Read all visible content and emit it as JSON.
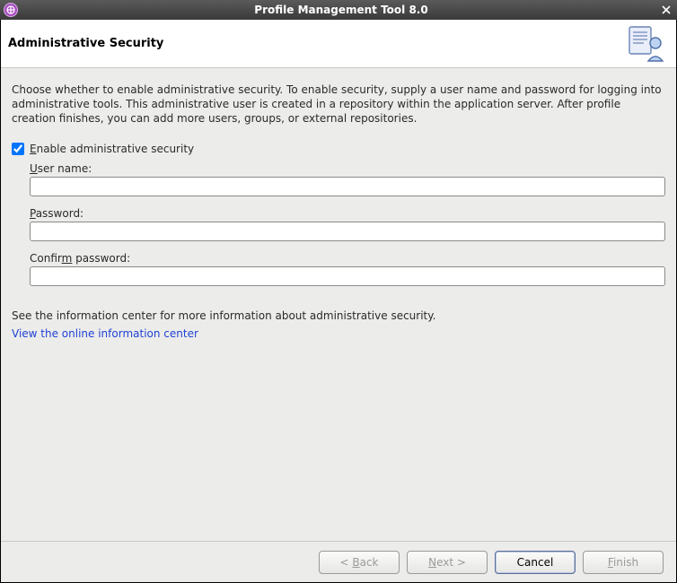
{
  "window": {
    "title": "Profile Management Tool 8.0"
  },
  "header": {
    "page_title": "Administrative Security"
  },
  "content": {
    "description": "Choose whether to enable administrative security. To enable security, supply a user name and password for logging into administrative tools. This administrative user is created in a repository within the application server. After profile creation finishes, you can add more users, groups, or external repositories.",
    "enable_checkbox": {
      "checked": true,
      "prefix": "",
      "hotkey": "E",
      "suffix": "nable administrative security"
    },
    "username": {
      "label_prefix": "",
      "label_hotkey": "U",
      "label_suffix": "ser name:",
      "value": ""
    },
    "password": {
      "label_prefix": "",
      "label_hotkey": "P",
      "label_suffix": "assword:",
      "value": ""
    },
    "confirm": {
      "label_prefix": "Confir",
      "label_hotkey": "m",
      "label_suffix": " password:",
      "value": ""
    },
    "info_line": "See the information center for more information about administrative security.",
    "link_text": "View the online information center"
  },
  "buttons": {
    "back": {
      "prefix": "< ",
      "hotkey": "B",
      "suffix": "ack",
      "enabled": false
    },
    "next": {
      "prefix": "",
      "hotkey": "N",
      "suffix": "ext >",
      "enabled": false
    },
    "cancel": {
      "label": "Cancel",
      "enabled": true
    },
    "finish": {
      "prefix": "",
      "hotkey": "F",
      "suffix": "inish",
      "enabled": false
    }
  }
}
